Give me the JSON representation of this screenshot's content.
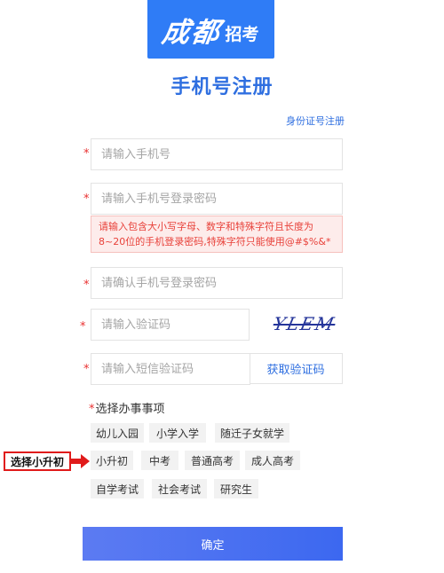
{
  "logo": {
    "brush_text": "成都",
    "small_text": "招考"
  },
  "page_title": "手机号注册",
  "alt_register_link": "身份证号注册",
  "fields": {
    "phone_placeholder": "请输入手机号",
    "password_placeholder": "请输入手机号登录密码",
    "password_hint": "请输入包含大小写字母、数字和特殊字符且长度为8~20位的手机登录密码,特殊字符只能使用@#$%&*",
    "confirm_password_placeholder": "请确认手机号登录密码",
    "captcha_placeholder": "请输入验证码",
    "captcha_text": "YLEM",
    "sms_placeholder": "请输入短信验证码",
    "sms_button": "获取验证码"
  },
  "matters": {
    "label": "选择办事事项",
    "options": [
      "幼儿入园",
      "小学入学",
      "随迁子女就学",
      "小升初",
      "中考",
      "普通高考",
      "成人高考",
      "自学考试",
      "社会考试",
      "研究生"
    ]
  },
  "annotation": {
    "label": "选择小升初",
    "color": "#e01b1b"
  },
  "submit_label": "确定",
  "colors": {
    "primary": "#2f7cf6",
    "link": "#2f6fe0",
    "required": "#e93030",
    "hint_bg": "#fdeceb"
  }
}
